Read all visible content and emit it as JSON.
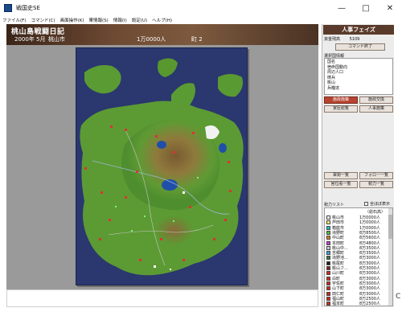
{
  "window": {
    "title": "戦国史SE",
    "controls": {
      "minimize": "—",
      "maximize": "□",
      "close": "✕"
    }
  },
  "menu": [
    "ファイル(F)",
    "コマンド(C)",
    "画面操作(K)",
    "軍情報(S)",
    "情報(I)",
    "設定(U)",
    "ヘルプ(H)"
  ],
  "header": {
    "title": "桃山島戦闘日記",
    "date": "2000年  5月",
    "city": "桃山市",
    "population": "1万0000人",
    "count": "町  2"
  },
  "panel": {
    "title": "人事フェイズ",
    "fund_label": "資金残高",
    "fund_value": "5109",
    "end_command": "コマンド終了",
    "city_list_label": "選択国情報",
    "city_items": [
      "国名",
      "宿命国動向",
      "周辺人口",
      "徴兵",
      "桃山",
      "兵糧達"
    ],
    "buttons": {
      "a1": "施政施策",
      "a2": "施政交換",
      "b1": "家臣総覧",
      "b2": "人事施策",
      "c1": "軍勢一覧",
      "c2": "フォロー一覧",
      "d1": "官位看一覧",
      "d2": "勢力一覧"
    },
    "power_list_label": "勢力リスト",
    "checkbox_label": "全ほぼ表示",
    "power_header": "（総石高）",
    "powers": [
      {
        "name": "桃山市",
        "pop": "1万0000人",
        "color": "#ffffff"
      },
      {
        "name": "芦田市",
        "pop": "1万0000人",
        "color": "#f7f36a"
      },
      {
        "name": "箱庭市",
        "pop": "1万0000人",
        "color": "#20c0c8"
      },
      {
        "name": "滝野町",
        "pop": "8万8500人",
        "color": "#49c23c"
      },
      {
        "name": "中山町",
        "pop": "8万5600人",
        "color": "#e07a1d"
      },
      {
        "name": "本田町",
        "pop": "8万4800人",
        "color": "#c53ad1"
      },
      {
        "name": "桃山中...",
        "pop": "8万3500人",
        "color": "#c9c9c9"
      },
      {
        "name": "吉郷町",
        "pop": "8万3500人",
        "color": "#31a3e8"
      },
      {
        "name": "滝野池...",
        "pop": "8万3000人",
        "color": "#2b7f3a"
      },
      {
        "name": "桃尾町",
        "pop": "8万3000人",
        "color": "#1e1e1e"
      },
      {
        "name": "桃山フ...",
        "pop": "8万3000人",
        "color": "#8a1b1b"
      },
      {
        "name": "山川町",
        "pop": "8万3000人",
        "color": "#d4261c"
      },
      {
        "name": "白町",
        "pop": "8万3000人",
        "color": "#d4261c"
      },
      {
        "name": "宇佐町",
        "pop": "8万3000人",
        "color": "#d4261c"
      },
      {
        "name": "山下町",
        "pop": "8万3000人",
        "color": "#d4261c"
      },
      {
        "name": "田仁町",
        "pop": "8万3000人",
        "color": "#d4261c"
      },
      {
        "name": "福山町",
        "pop": "8万2500人",
        "color": "#d4261c"
      },
      {
        "name": "福本町",
        "pop": "8万2500人",
        "color": "#d4261c"
      }
    ]
  },
  "edge_char": "C"
}
